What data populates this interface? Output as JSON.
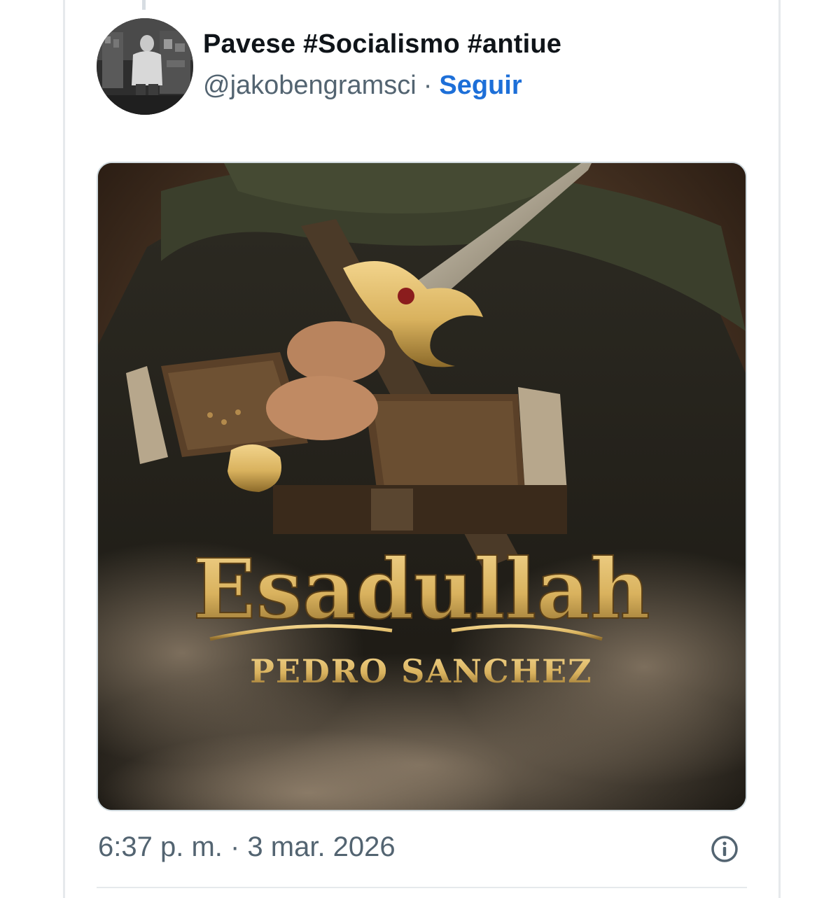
{
  "tweet": {
    "author_name": "Pavese #Socialismo #antiue",
    "handle": "@jakobengramsci",
    "separator": "·",
    "follow_label": "Seguir",
    "timestamp": "6:37 p. m. · 3 mar. 2026"
  },
  "media": {
    "poster_title": "Esadullah",
    "poster_subtitle": "PEDRO SANCHEZ"
  },
  "icons": {
    "info": "info-circle-icon"
  },
  "colors": {
    "name_text": "#0f1419",
    "secondary_text": "#536471",
    "follow_link": "#1d6fd8",
    "poster_gold": "#d9b25e"
  }
}
